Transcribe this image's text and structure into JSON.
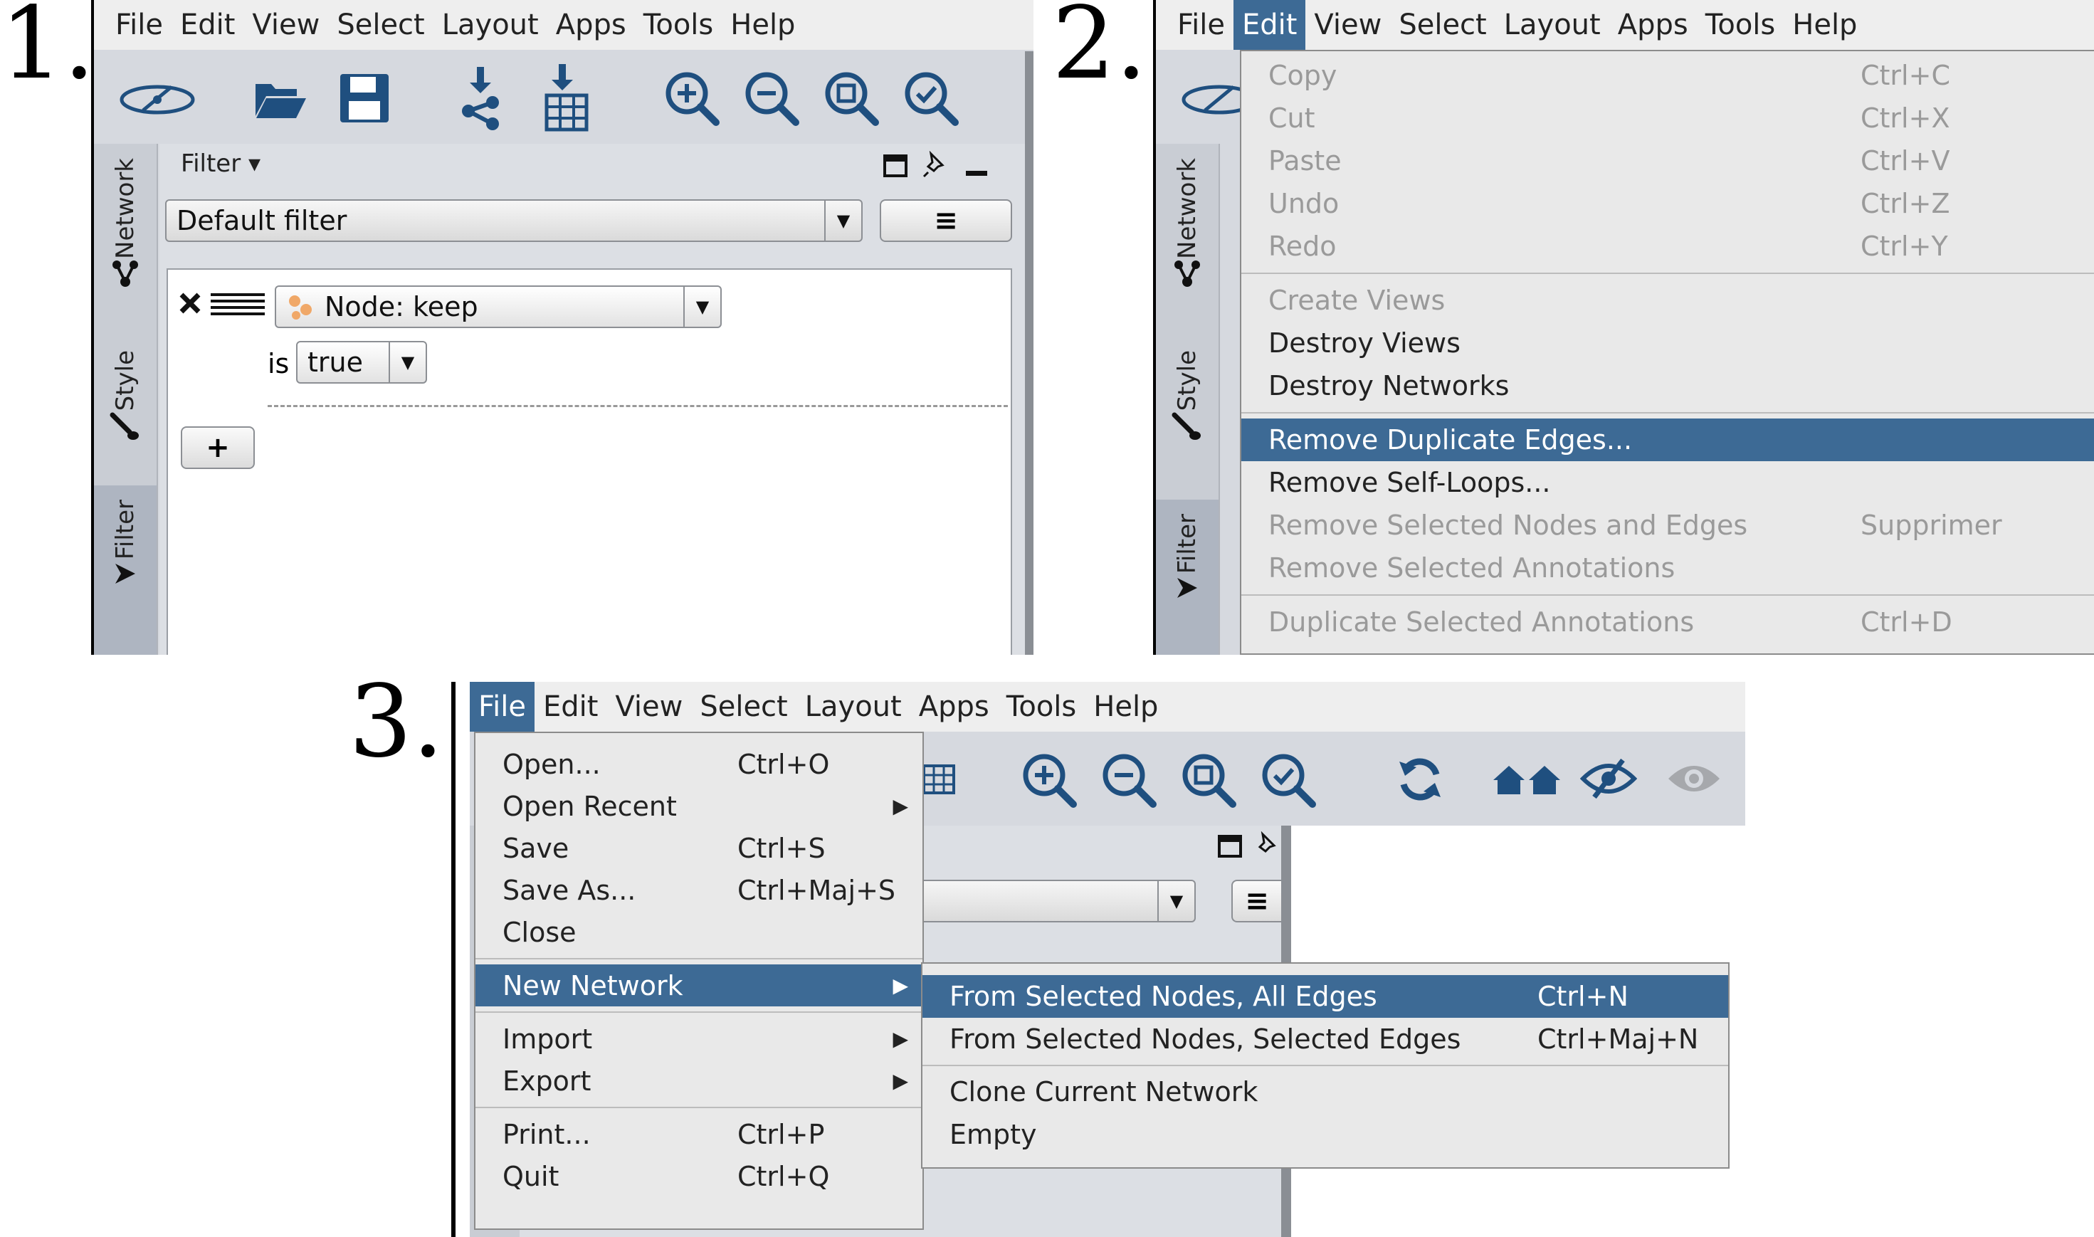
{
  "steps": [
    "1.",
    "2.",
    "3."
  ],
  "menubar": [
    "File",
    "Edit",
    "View",
    "Select",
    "Layout",
    "Apps",
    "Tools",
    "Help"
  ],
  "side_tabs": {
    "network": "Network",
    "style": "Style",
    "filter": "Filter"
  },
  "filter_panel": {
    "title": "Filter ▾",
    "filter_select": "Default filter",
    "node_select": "Node: keep",
    "is_label": "is",
    "value_select": "true",
    "add_label": "+",
    "menu_glyph": "≡"
  },
  "edit_menu": [
    {
      "label": "Copy",
      "shortcut": "Ctrl+C",
      "state": "disabled"
    },
    {
      "label": "Cut",
      "shortcut": "Ctrl+X",
      "state": "disabled"
    },
    {
      "label": "Paste",
      "shortcut": "Ctrl+V",
      "state": "disabled"
    },
    {
      "label": "Undo",
      "shortcut": "Ctrl+Z",
      "state": "disabled"
    },
    {
      "label": "Redo",
      "shortcut": "Ctrl+Y",
      "state": "disabled"
    },
    {
      "label": "Create Views",
      "shortcut": "",
      "state": "disabled"
    },
    {
      "label": "Destroy Views",
      "shortcut": "",
      "state": "enabled"
    },
    {
      "label": "Destroy Networks",
      "shortcut": "",
      "state": "enabled"
    },
    {
      "label": "Remove Duplicate Edges...",
      "shortcut": "",
      "state": "highlighted"
    },
    {
      "label": "Remove Self-Loops...",
      "shortcut": "",
      "state": "enabled"
    },
    {
      "label": "Remove Selected Nodes and Edges",
      "shortcut": "Supprimer",
      "state": "disabled"
    },
    {
      "label": "Remove Selected Annotations",
      "shortcut": "",
      "state": "disabled"
    },
    {
      "label": "Duplicate Selected Annotations",
      "shortcut": "Ctrl+D",
      "state": "disabled"
    }
  ],
  "file_menu": [
    {
      "label": "Open...",
      "shortcut": "Ctrl+O",
      "submenu": false,
      "state": "enabled"
    },
    {
      "label": "Open Recent",
      "shortcut": "",
      "submenu": true,
      "state": "enabled"
    },
    {
      "label": "Save",
      "shortcut": "Ctrl+S",
      "submenu": false,
      "state": "enabled"
    },
    {
      "label": "Save As...",
      "shortcut": "Ctrl+Maj+S",
      "submenu": false,
      "state": "enabled"
    },
    {
      "label": "Close",
      "shortcut": "",
      "submenu": false,
      "state": "enabled"
    },
    {
      "label": "New Network",
      "shortcut": "",
      "submenu": true,
      "state": "highlighted"
    },
    {
      "label": "Import",
      "shortcut": "",
      "submenu": true,
      "state": "enabled"
    },
    {
      "label": "Export",
      "shortcut": "",
      "submenu": true,
      "state": "enabled"
    },
    {
      "label": "Print...",
      "shortcut": "Ctrl+P",
      "submenu": false,
      "state": "enabled"
    },
    {
      "label": "Quit",
      "shortcut": "Ctrl+Q",
      "submenu": false,
      "state": "enabled"
    }
  ],
  "new_network_submenu": [
    {
      "label": "From Selected Nodes, All Edges",
      "shortcut": "Ctrl+N",
      "state": "highlighted"
    },
    {
      "label": "From Selected Nodes, Selected Edges",
      "shortcut": "Ctrl+Maj+N",
      "state": "enabled"
    },
    {
      "label": "Clone Current Network",
      "shortcut": "",
      "state": "enabled"
    },
    {
      "label": "Empty",
      "shortcut": "",
      "state": "enabled"
    }
  ],
  "submenu_arrow": "▶",
  "colors": {
    "highlight": "#3d6a95",
    "icon_blue": "#1f4f7f",
    "panel_bg": "#d6d9df"
  }
}
